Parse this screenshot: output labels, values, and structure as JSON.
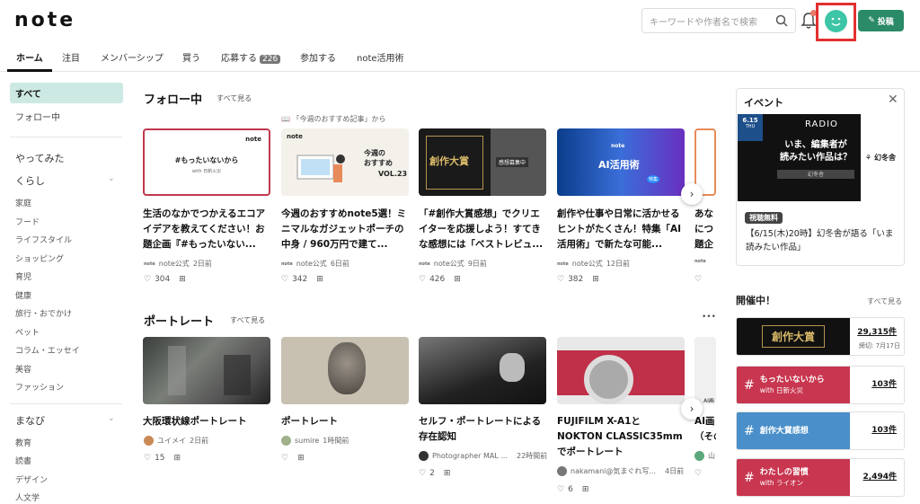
{
  "header": {
    "logo": "note",
    "search_placeholder": "キーワードや作者名で検索",
    "post_label": "投稿"
  },
  "tabs": [
    {
      "label": "ホーム",
      "active": true
    },
    {
      "label": "注目"
    },
    {
      "label": "メンバーシップ"
    },
    {
      "label": "買う"
    },
    {
      "label": "応募する",
      "badge": "226"
    },
    {
      "label": "参加する"
    },
    {
      "label": "note活用術"
    }
  ],
  "sidebar": {
    "top": [
      "すべて",
      "フォロー中"
    ],
    "yattemita": "やってみた",
    "kurashi": "くらし",
    "kurashi_items": [
      "家庭",
      "フード",
      "ライフスタイル",
      "ショッピング",
      "育児",
      "健康",
      "旅行・おでかけ",
      "ペット",
      "コラム・エッセイ",
      "美容",
      "ファッション"
    ],
    "manabi": "まなび",
    "manabi_items": [
      "教育",
      "読書",
      "デザイン",
      "人文学"
    ]
  },
  "follow": {
    "title": "フォロー中",
    "see_all": "すべて見る",
    "rec_note": "「今週のおすすめ記事」から",
    "cards": [
      {
        "title": "生活のなかでつかえるエコアイデアを教えてください！お題企画『#もったいない...",
        "author": "note公式",
        "time": "2日前",
        "likes": "304",
        "thumb_text": "#もったいないから",
        "thumb_sub": "with 日新火災"
      },
      {
        "title": "今週のおすすめnote5選！ミニマルなガジェットポーチの中身 / 960万円で建て...",
        "author": "note公式",
        "time": "6日前",
        "likes": "342",
        "thumb_text": "今週の\nおすすめ",
        "thumb_sub": "VOL.23"
      },
      {
        "title": "「#創作大賞感想」でクリエイターを応援しよう！すてきな感想には「ベストレビュ...",
        "author": "note公式",
        "time": "9日前",
        "likes": "426",
        "thumb_text": "創作大賞",
        "thumb_sub": "感想募集中"
      },
      {
        "title": "創作や仕事や日常に活かせるヒントがたくさん！特集「AI活用術」で新たな可能...",
        "author": "note公式",
        "time": "12日前",
        "likes": "382",
        "thumb_text": "AI活用術",
        "thumb_sub": "特集"
      },
      {
        "title": "あな\nにつ\n題企",
        "author": "",
        "time": "",
        "likes": ""
      }
    ]
  },
  "portrait": {
    "title": "ポートレート",
    "see_all": "すべて見る",
    "more": "•••",
    "cards": [
      {
        "title": "大阪環状線ポートレート",
        "author": "ユイメイ",
        "time": "2日前",
        "likes": "15"
      },
      {
        "title": "ポートレート",
        "author": "sumire",
        "time": "1時間前",
        "likes": ""
      },
      {
        "title": "セルフ・ポートレートによる存在認知",
        "author": "Photographer MAL ...",
        "time": "22時間前",
        "likes": "2"
      },
      {
        "title": "FUJIFILM X-A1とNOKTON CLASSIC35mmでポートレート",
        "author": "nakamani@気まぐれ写...",
        "time": "4日前",
        "likes": "6"
      },
      {
        "title": "AI画\n（その",
        "author": "山",
        "time": "",
        "likes": ""
      }
    ]
  },
  "event": {
    "title": "イベント",
    "date": "6.15",
    "day": "THU",
    "radio": "RADIO",
    "headline": "いま、編集者が\n読みたい作品は？",
    "publisher": "幻冬舎",
    "badge": "視聴無料",
    "text": "【6/15(木)20時】幻冬舎が語る「いま読みたい作品」"
  },
  "open": {
    "title": "開催中！",
    "see_all": "すべて見る",
    "items": [
      {
        "name": "創作大賞",
        "count": "29,315件",
        "extra": "締切: 7月17日",
        "color": "#111111"
      },
      {
        "name": "もったいないから",
        "sub": "with 日新火災",
        "count": "103件",
        "color": "#c8364f"
      },
      {
        "name": "創作大賞感想",
        "sub": "",
        "count": "103件",
        "color": "#4a8fc9"
      },
      {
        "name": "わたしの習慣",
        "sub": "with ライオン",
        "count": "2,494件",
        "color": "#c8364f"
      }
    ]
  },
  "colors": {
    "accent": "#2b8a68",
    "avatar": "#3cc5a6",
    "highlight": "#e23030"
  }
}
